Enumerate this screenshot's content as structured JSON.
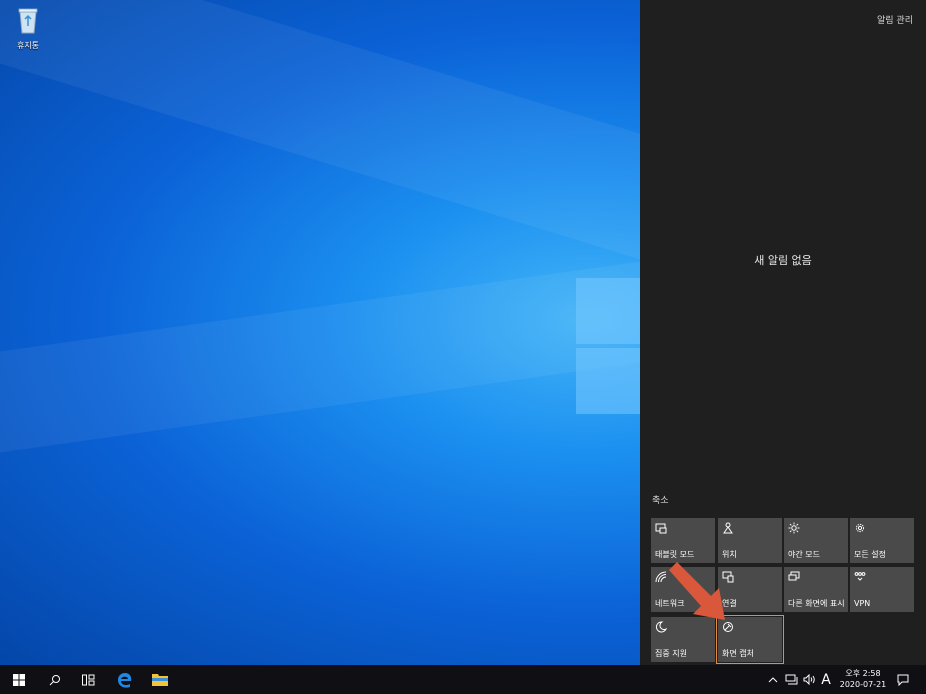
{
  "desktop": {
    "recycle_bin_label": "휴지통"
  },
  "action_center": {
    "manage_notifications": "알림 관리",
    "no_notifications": "새 알림 없음",
    "collapse": "축소",
    "tiles": [
      {
        "label": "태블릿 모드",
        "icon": "tablet-mode-icon"
      },
      {
        "label": "위치",
        "icon": "location-icon"
      },
      {
        "label": "야간 모드",
        "icon": "night-light-icon"
      },
      {
        "label": "모든 설정",
        "icon": "settings-gear-icon"
      },
      {
        "label": "네트워크",
        "icon": "network-icon"
      },
      {
        "label": "연결",
        "icon": "connect-icon"
      },
      {
        "label": "다른 화면에 표시",
        "icon": "project-icon"
      },
      {
        "label": "VPN",
        "icon": "vpn-icon"
      },
      {
        "label": "집중 지원",
        "icon": "focus-assist-icon"
      },
      {
        "label": "화면 캡처",
        "icon": "screen-snip-icon"
      }
    ],
    "highlight_color": "#e88b3a",
    "arrow_color": "#d9573a"
  },
  "taskbar": {
    "tray": {
      "ime_indicator": "A",
      "time": "오후 2:58",
      "date": "2020-07-21"
    }
  }
}
